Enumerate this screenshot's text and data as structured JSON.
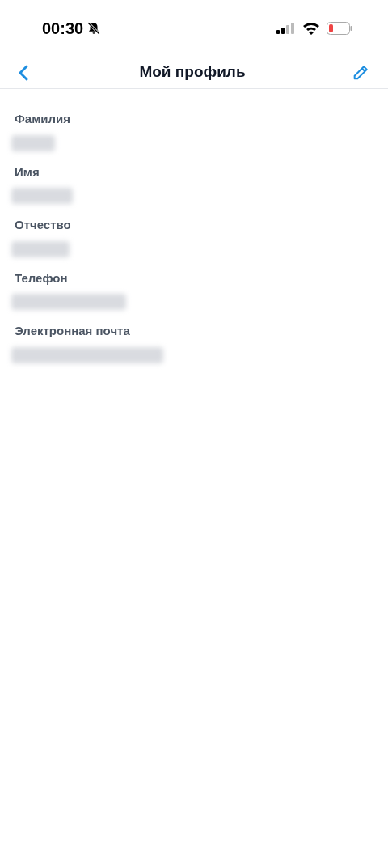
{
  "status_bar": {
    "time": "00:30",
    "silent": true
  },
  "header": {
    "title": "Мой профиль"
  },
  "fields": [
    {
      "label": "Фамилия",
      "value_redacted": true
    },
    {
      "label": "Имя",
      "value_redacted": true
    },
    {
      "label": "Отчество",
      "value_redacted": true
    },
    {
      "label": "Телефон",
      "value_redacted": true
    },
    {
      "label": "Электронная почта",
      "value_redacted": true
    }
  ]
}
